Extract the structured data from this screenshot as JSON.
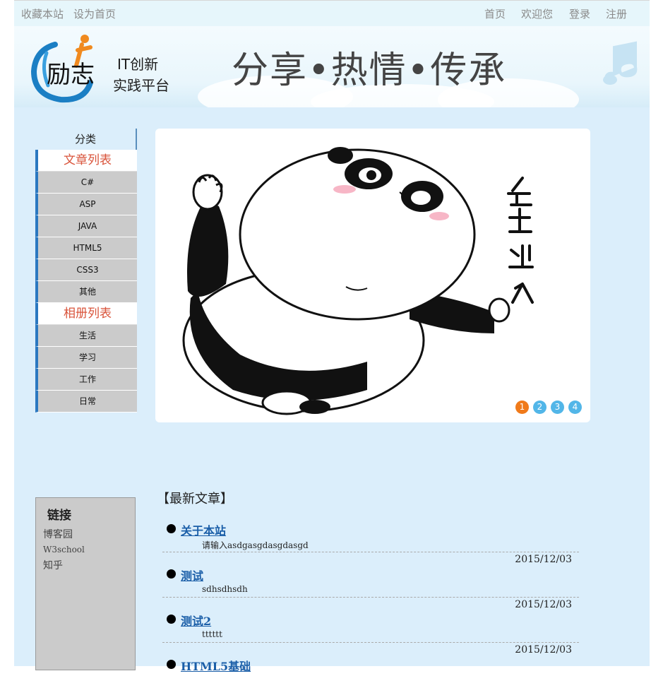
{
  "topbar": {
    "left_links": [
      "收藏本站",
      "设为首页"
    ],
    "right_links": [
      "首页",
      "欢迎您",
      "登录",
      "注册"
    ]
  },
  "header": {
    "logo_text_line1": "IT创新",
    "logo_text_line2": "实践平台",
    "logo_glyphs": "励志",
    "slogan": "分享•热情•传承"
  },
  "sidebar": {
    "title": "分类",
    "groups": [
      {
        "label": "文章列表",
        "items": [
          "C#",
          "ASP",
          "JAVA",
          "HTML5",
          "CSS3",
          "其他"
        ]
      },
      {
        "label": "相册列表",
        "items": [
          "生活",
          "学习",
          "工作",
          "日常"
        ]
      }
    ]
  },
  "banner": {
    "artwork_text": "点击进入",
    "pager": [
      "1",
      "2",
      "3",
      "4"
    ],
    "active_index": 0
  },
  "links": {
    "title": "链接",
    "items": [
      "博客园",
      "W3school",
      "知乎"
    ]
  },
  "latest": {
    "title": "【最新文章】",
    "articles": [
      {
        "title": "关于本站",
        "summary": "请输入asdgasgdasgdasgd",
        "date": ""
      },
      {
        "title": "测试",
        "summary": "sdhsdhsdh",
        "date": "2015/12/03"
      },
      {
        "title": "测试2",
        "summary": "tttttt",
        "date": "2015/12/03"
      },
      {
        "title": "HTML5基础",
        "summary": "",
        "date": "2015/12/03"
      }
    ]
  },
  "colors": {
    "page_bg": "#dbeefb",
    "accent_red": "#d9533a",
    "accent_blue": "#2b78c0",
    "pager_active": "#f07a1a",
    "pager_inactive": "#52b6e8",
    "link_blue": "#1a5ea8"
  }
}
